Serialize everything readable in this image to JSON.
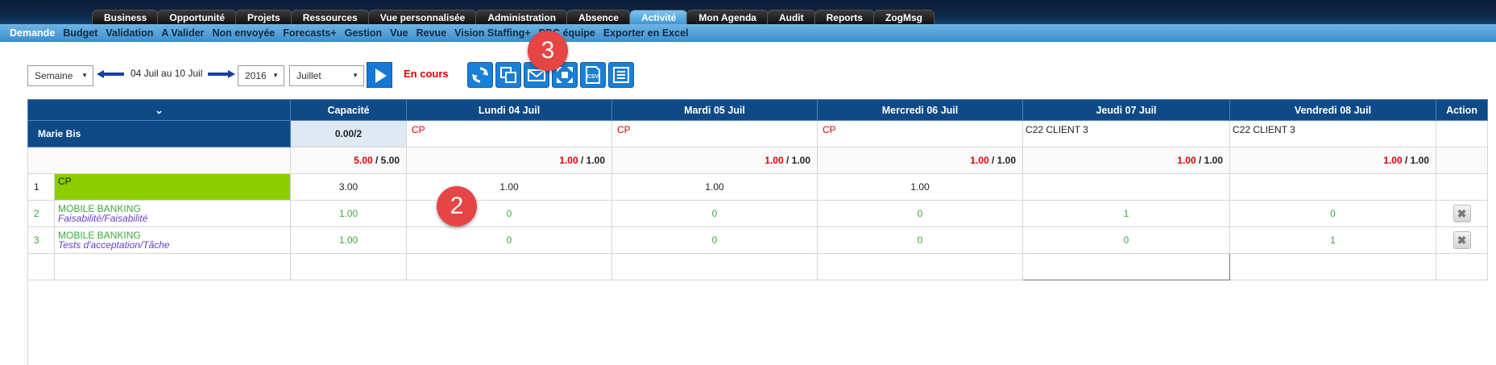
{
  "top_tabs": [
    "Business",
    "Opportunité",
    "Projets",
    "Ressources",
    "Vue personnalisée",
    "Administration",
    "Absence",
    "Activité",
    "Mon Agenda",
    "Audit",
    "Reports",
    "ZogMsg"
  ],
  "active_tab": "Activité",
  "sub_menu": [
    "Demande",
    "Budget",
    "Validation",
    "A Valider",
    "Non envoyée",
    "Forecasts+",
    "Gestion",
    "Vue",
    "Revue",
    "Vision Staffing+",
    "PDC équipe",
    "Exporter en Excel"
  ],
  "toolbar": {
    "period_select": "Semaine",
    "date_range": "04 Juil au 10 Juil",
    "year_select": "2016",
    "month_select": "Juillet",
    "status": "En cours",
    "icons": [
      "refresh-icon",
      "copy-icon",
      "email-icon",
      "fullscreen-icon",
      "csv-icon",
      "list-icon"
    ]
  },
  "badges": {
    "b2": "2",
    "b3": "3"
  },
  "grid": {
    "headers": {
      "collapse": "⌄",
      "capacity": "Capacité",
      "d1": "Lundi 04 Juil",
      "d2": "Mardi 05 Juil",
      "d3": "Mercredi 06 Juil",
      "d4": "Jeudi 07 Juil",
      "d5": "Vendredi 08 Juil",
      "action": "Action"
    },
    "person": {
      "name": "Marie Bis",
      "capacity": "0.00/2",
      "d1": "CP",
      "d2": "CP",
      "d3": "CP",
      "d4": "C22 CLIENT 3",
      "d5": "C22 CLIENT 3"
    },
    "totals": {
      "sep": " / ",
      "capacity_a": "5.00",
      "capacity_b": "5.00",
      "d1_a": "1.00",
      "d1_b": "1.00",
      "d2_a": "1.00",
      "d2_b": "1.00",
      "d3_a": "1.00",
      "d3_b": "1.00",
      "d4_a": "1.00",
      "d4_b": "1.00",
      "d5_a": "1.00",
      "d5_b": "1.00"
    },
    "rows": [
      {
        "no": "1",
        "label": "CP",
        "capacity": "3.00",
        "d1": "1.00",
        "d2": "1.00",
        "d3": "1.00",
        "d4": "",
        "d5": ""
      },
      {
        "no": "2",
        "project": "MOBILE BANKING",
        "task": "Faisabilité/Faisabilité",
        "capacity": "1.00",
        "d1": "0",
        "d2": "0",
        "d3": "0",
        "d4": "1",
        "d5": "0",
        "action_icon": "✖"
      },
      {
        "no": "3",
        "project": "MOBILE BANKING",
        "task": "Tests d'acceptation/Tâche",
        "capacity": "1.00",
        "d1": "0",
        "d2": "0",
        "d3": "0",
        "d4": "0",
        "d5": "1",
        "action_icon": "✖"
      }
    ]
  }
}
